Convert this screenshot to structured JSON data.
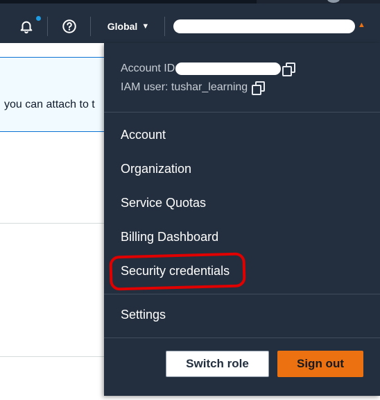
{
  "topbar": {
    "region_label": "Global",
    "account_name": "",
    "icons": {
      "notifications": "bell-icon",
      "help": "help-circle-icon",
      "region_caret": "caret-down-icon",
      "account_caret": "caret-up-icon"
    },
    "colors": {
      "background": "#232f3e",
      "notification_dot": "#1d9be3",
      "account_caret": "#ec7211"
    }
  },
  "background_page": {
    "info_text": "you can attach to t"
  },
  "account_menu": {
    "account_id_label": "Account ID:",
    "account_id_value": "",
    "iam_user_label": "IAM user: tushar_learning",
    "items": [
      {
        "label": "Account"
      },
      {
        "label": "Organization"
      },
      {
        "label": "Service Quotas"
      },
      {
        "label": "Billing Dashboard"
      },
      {
        "label": "Security credentials",
        "highlighted": true
      }
    ],
    "settings_label": "Settings",
    "switch_role_label": "Switch role",
    "sign_out_label": "Sign out",
    "colors": {
      "menu_background": "#232f3e",
      "sign_out_button": "#ec7211",
      "annotation_ring": "#e00000"
    }
  }
}
